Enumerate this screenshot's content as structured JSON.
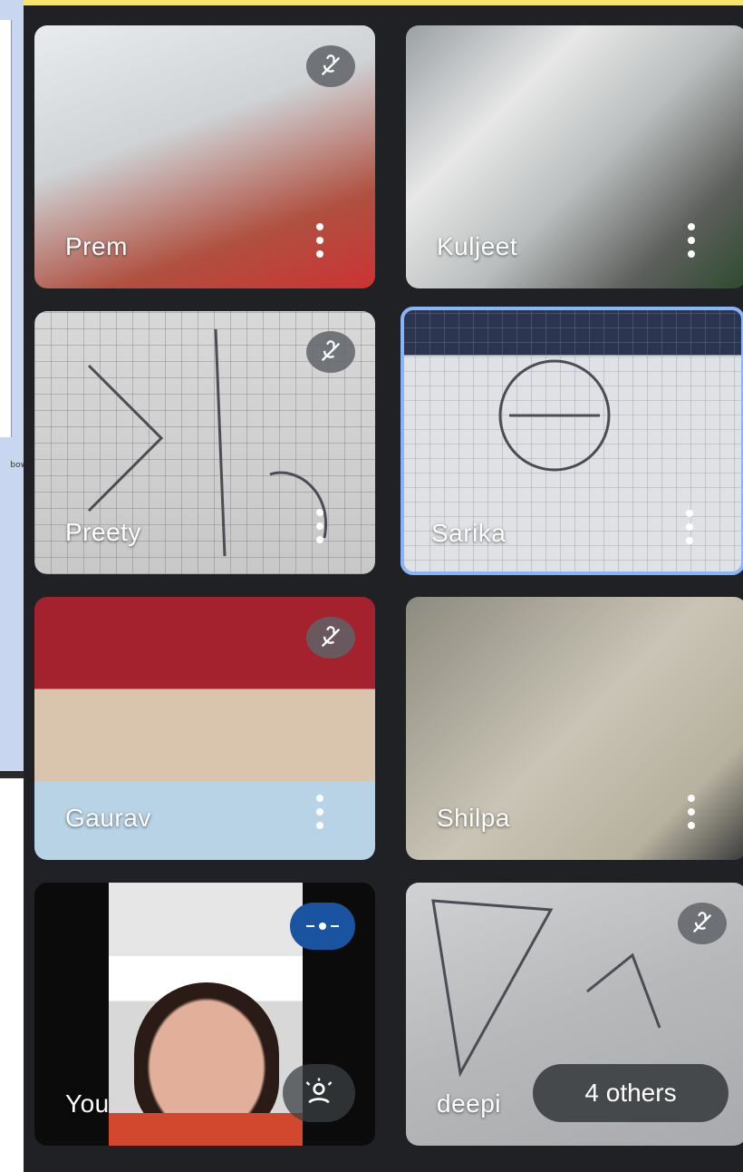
{
  "background_window": {
    "cut_text": "bow"
  },
  "participants": [
    {
      "name": "Prem",
      "muted": true,
      "active": false
    },
    {
      "name": "Kuljeet",
      "muted": false,
      "active": false
    },
    {
      "name": "Preety",
      "muted": true,
      "active": false
    },
    {
      "name": "Sarika",
      "muted": false,
      "active": true
    },
    {
      "name": "Gaurav",
      "muted": true,
      "active": false
    },
    {
      "name": "Shilpa",
      "muted": false,
      "active": false
    },
    {
      "name": "You",
      "muted": false,
      "presenting": true,
      "active": false
    },
    {
      "name": "deepi",
      "muted": true,
      "active": false
    }
  ],
  "others_chip": {
    "label": "4 others"
  },
  "icons": {
    "mute": "mic-off-icon",
    "more": "more-vert-icon",
    "present": "presenting-icon",
    "frame": "frame-person-icon"
  },
  "colors": {
    "stage": "#202124",
    "active_border": "#8ab4f8",
    "present_chip": "#1a53a0"
  }
}
